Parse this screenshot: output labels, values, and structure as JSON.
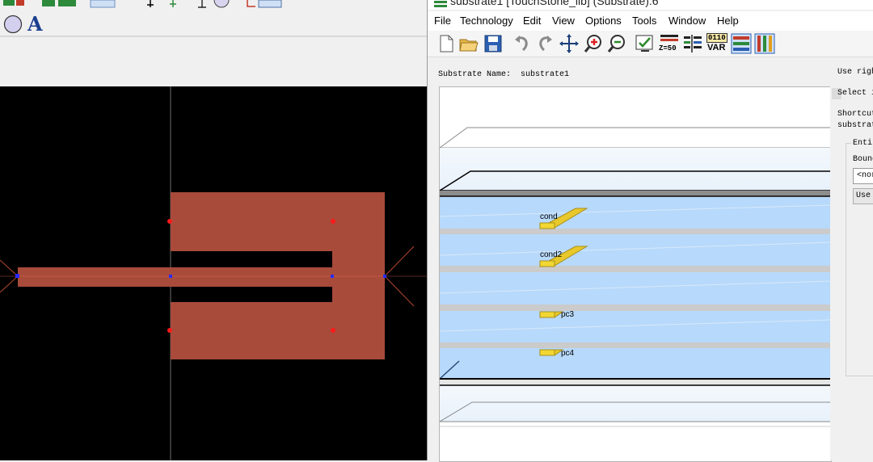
{
  "right_window": {
    "title": "substrate1 [TouchStone_lib] (Substrate):6",
    "menu": [
      "File",
      "Technology",
      "Edit",
      "View",
      "Options",
      "Tools",
      "Window",
      "Help"
    ],
    "toolbar_labels": {
      "impedance": "Z=50",
      "binary": "0110",
      "var": "VAR"
    },
    "substrate_name_label": "Substrate Name:",
    "substrate_name_value": "substrate1",
    "side_panel": {
      "line1": "Use righ",
      "line2": "Select i",
      "line3": "Shortcut",
      "line4": "substrat",
      "group_title": "Entir",
      "bounding_label": "Bound",
      "select_value": "<nor",
      "use_button": "Use"
    },
    "layers": {
      "cond": "cond",
      "cond2": "cond2",
      "pc3": "pc3",
      "pc4": "pc4"
    }
  },
  "left_window": {
    "shape_color": "#a84b3b"
  }
}
